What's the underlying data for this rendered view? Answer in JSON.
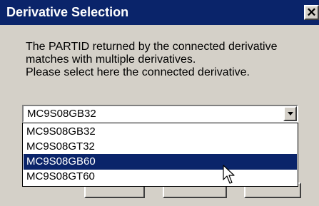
{
  "window": {
    "title": "Derivative Selection",
    "close_glyph": "✕"
  },
  "message": {
    "line1": "The PARTID returned by the connected derivative",
    "line2": "matches with multiple derivatives.",
    "line3": "Please select here the connected derivative."
  },
  "combo": {
    "value": "MC9S08GB32",
    "arrow_icon": "chevron-down-icon"
  },
  "dropdown": {
    "items": [
      {
        "label": "MC9S08GB32",
        "selected": false
      },
      {
        "label": "MC9S08GT32",
        "selected": false
      },
      {
        "label": "MC9S08GB60",
        "selected": true
      },
      {
        "label": "MC9S08GT60",
        "selected": false
      }
    ]
  },
  "colors": {
    "titlebar": "#0a246a",
    "dialog_face": "#d4d0c8",
    "selection": "#0a246a"
  }
}
